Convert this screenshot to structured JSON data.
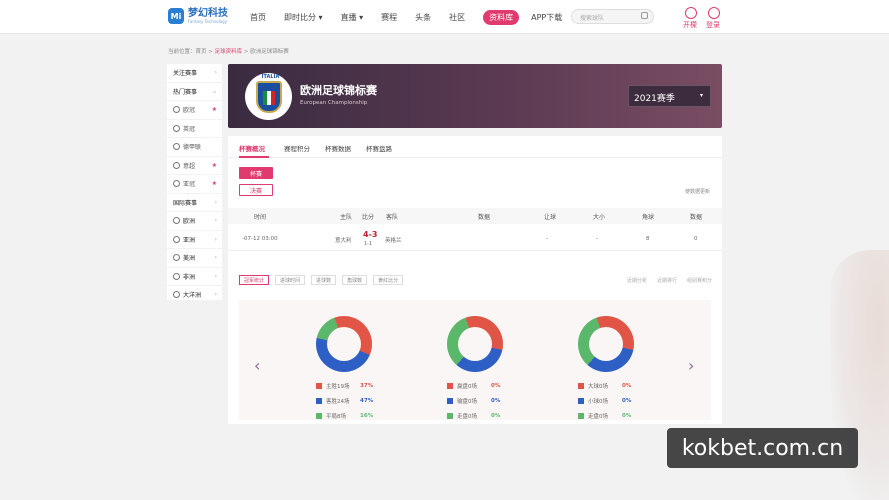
{
  "logo": {
    "mark": "Mi",
    "text": "梦幻科技",
    "sub": "Fantasy Technology"
  },
  "nav": {
    "items": [
      "首页",
      "即时比分 ▾",
      "直播 ▾",
      "赛程",
      "头条",
      "社区",
      "资料库",
      "APP下载"
    ],
    "active": "资料库"
  },
  "search": {
    "placeholder": "搜索球队"
  },
  "header_actions": {
    "open_label": "开檬",
    "login_label": "登录"
  },
  "breadcrumb": {
    "prefix": "当前位置：",
    "home": "首页",
    "sep1": " > ",
    "library": "足球资料库",
    "sep2": " > ",
    "current": "欧洲足球锦标赛"
  },
  "sidebar": {
    "items": [
      {
        "label": "关注赛事",
        "mark": "›"
      },
      {
        "label": "热门赛事",
        "mark": "⌄"
      },
      {
        "label": "欧冠",
        "mark": "★"
      },
      {
        "label": "英冠",
        "mark": ""
      },
      {
        "label": "德甲联",
        "mark": ""
      },
      {
        "label": "意超",
        "mark": "★"
      },
      {
        "label": "亚冠",
        "mark": "★"
      },
      {
        "label": "国际赛事",
        "mark": "›"
      },
      {
        "label": "欧洲",
        "mark": "›"
      },
      {
        "label": "亚洲",
        "mark": "›"
      },
      {
        "label": "美洲",
        "mark": "›"
      },
      {
        "label": "非洲",
        "mark": "›"
      },
      {
        "label": "大洋洲",
        "mark": "›"
      }
    ]
  },
  "banner": {
    "emblem_text": "ITALIA",
    "title": "欧洲足球锦标赛",
    "subtitle": "European Championship",
    "season": "2021赛季",
    "season_caret": "▾"
  },
  "tabs": [
    "杯赛概况",
    "赛程积分",
    "杯赛数据",
    "杯赛盘路"
  ],
  "stage_buttons": {
    "group": "杯赛",
    "final": "决赛"
  },
  "hint": "使数据更新",
  "table": {
    "headers": [
      "时间",
      "主队",
      "比分",
      "客队",
      "数据",
      "让球",
      "大小",
      "角球",
      "数据"
    ],
    "row": {
      "time": "-07-12 03:00",
      "home": "意大利",
      "score": "4-3",
      "half": "1-1",
      "away": "英格兰",
      "handicap": "-",
      "overunder": "-",
      "corners": "8",
      "data": "0"
    }
  },
  "subtabs": [
    "冠军统计",
    "进球时间",
    "进球数",
    "角球数",
    "黄红比分"
  ],
  "filters": [
    "近期分析",
    "近期排行",
    "组别赛积分"
  ],
  "nav_arrows": {
    "prev": "‹",
    "next": "›"
  },
  "colors": {
    "red": "#e05545",
    "blue": "#2e5fc4",
    "green": "#5bb86a",
    "accent": "#e03a6e"
  },
  "stats": [
    {
      "legend": [
        {
          "label": "主胜19场",
          "pct": "37%"
        },
        {
          "label": "客胜24场",
          "pct": "47%"
        },
        {
          "label": "平局8场",
          "pct": "16%"
        }
      ],
      "slices": [
        0.37,
        0.47,
        0.16
      ]
    },
    {
      "legend": [
        {
          "label": "赢盘0场",
          "pct": "0%"
        },
        {
          "label": "输盘0场",
          "pct": "0%"
        },
        {
          "label": "走盘0场",
          "pct": "0%"
        }
      ],
      "slices": [
        0.34,
        0.33,
        0.33
      ]
    },
    {
      "legend": [
        {
          "label": "大球0场",
          "pct": "0%"
        },
        {
          "label": "小球0场",
          "pct": "0%"
        },
        {
          "label": "走盘0场",
          "pct": "0%"
        }
      ],
      "slices": [
        0.34,
        0.33,
        0.33
      ]
    }
  ],
  "watermark": "kokbet.com.cn"
}
